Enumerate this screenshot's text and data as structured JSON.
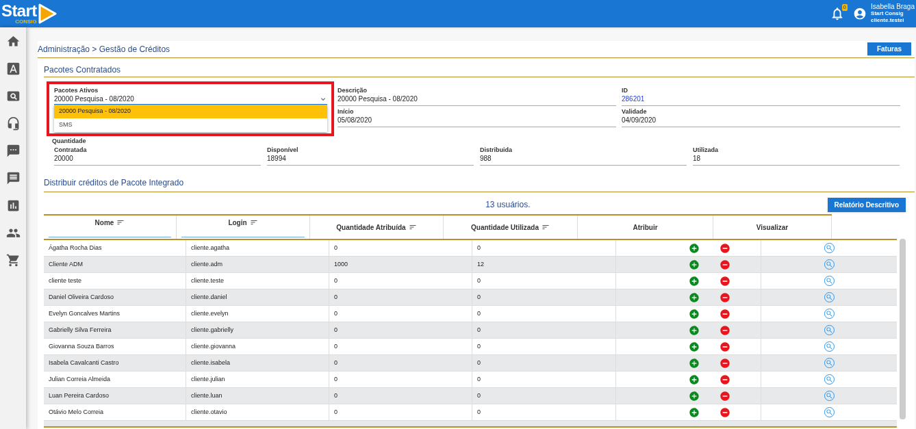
{
  "header": {
    "logo": {
      "word": "Start",
      "sub": "CONSIG"
    },
    "notifications": {
      "count": "0"
    },
    "user": {
      "name": "Isabella Braga",
      "company": "Start Consig",
      "login": "cliente.testei"
    }
  },
  "breadcrumb": "Administração > Gestão de Créditos",
  "invoices_button": "Faturas",
  "packages": {
    "title": "Pacotes Contratados",
    "active_select": {
      "label": "Pacotes Ativos",
      "value": "20000 Pesquisa - 08/2020",
      "expanded": true,
      "highlighted": true,
      "options": [
        {
          "label": "20000 Pesquisa - 08/2020",
          "selected": true
        },
        {
          "label": "SMS",
          "selected": false
        }
      ]
    },
    "fields": [
      {
        "label": "Descrição",
        "value": "20000 Pesquisa - 08/2020",
        "kind": "text"
      },
      {
        "label": "ID",
        "value": "286201",
        "kind": "link"
      },
      {
        "label": "Início",
        "value": "05/08/2020",
        "kind": "text"
      },
      {
        "label": "Validade",
        "value": "04/09/2020",
        "kind": "text"
      }
    ],
    "quantity_label": "Quantidade",
    "quantities": [
      {
        "label": "Contratada",
        "value": "20000"
      },
      {
        "label": "Disponível",
        "value": "18994"
      },
      {
        "label": "Distribuida",
        "value": "988"
      },
      {
        "label": "Utilizada",
        "value": "18"
      }
    ]
  },
  "distribution": {
    "title": "Distribuir créditos de Pacote Integrado",
    "count": "13 usuários.",
    "report_button": "Relatório Descritivo",
    "table": {
      "columns": [
        {
          "label": "Nome",
          "sortable": true,
          "filter": true
        },
        {
          "label": "Login",
          "sortable": true,
          "filter": true
        },
        {
          "label": "Quantidade Atribuída",
          "sortable": true,
          "filter": false
        },
        {
          "label": "Quantidade Utilizada",
          "sortable": true,
          "filter": false
        },
        {
          "label": "Atribuir",
          "sortable": false,
          "filter": false
        },
        {
          "label": "Visualizar",
          "sortable": false,
          "filter": false
        }
      ],
      "rows": [
        {
          "name": "Ágatha Rocha Dias",
          "login": "cliente.agatha",
          "assigned": "0",
          "used": "0"
        },
        {
          "name": "Cliente ADM",
          "login": "cliente.adm",
          "assigned": "1000",
          "used": "12"
        },
        {
          "name": "cliente teste",
          "login": "cliente.teste",
          "assigned": "0",
          "used": "0"
        },
        {
          "name": "Daniel Oliveira Cardoso",
          "login": "cliente.daniel",
          "assigned": "0",
          "used": "0"
        },
        {
          "name": "Evelyn Goncalves Martins",
          "login": "cliente.evelyn",
          "assigned": "0",
          "used": "0"
        },
        {
          "name": "Gabrielly Silva Ferreira",
          "login": "cliente.gabrielly",
          "assigned": "0",
          "used": "0"
        },
        {
          "name": "Giovanna Souza Barros",
          "login": "cliente.giovanna",
          "assigned": "0",
          "used": "0"
        },
        {
          "name": "Isabela Cavalcanti Castro",
          "login": "cliente.isabela",
          "assigned": "0",
          "used": "0"
        },
        {
          "name": "Julian Correia Almeida",
          "login": "cliente.julian",
          "assigned": "0",
          "used": "0"
        },
        {
          "name": "Luan Pereira Cardoso",
          "login": "cliente.luan",
          "assigned": "0",
          "used": "0"
        },
        {
          "name": "Otávio Melo Correia",
          "login": "cliente.otavio",
          "assigned": "0",
          "used": "0"
        }
      ]
    }
  }
}
